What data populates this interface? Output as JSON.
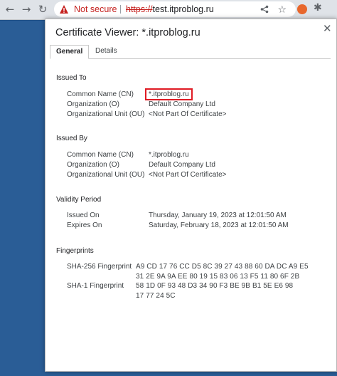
{
  "browser": {
    "back_icon": "←",
    "forward_icon": "→",
    "reload_icon": "↻",
    "security_label": "Not secure",
    "url_scheme": "https://",
    "url_rest": "test.itproblog.ru",
    "star_icon": "☆",
    "puzzle_icon": "✱"
  },
  "dialog": {
    "title": "Certificate Viewer: *.itproblog.ru",
    "close_icon": "✕",
    "tabs": [
      {
        "label": "General",
        "active": true
      },
      {
        "label": "Details",
        "active": false
      }
    ],
    "issued_to": {
      "heading": "Issued To",
      "rows": [
        {
          "label": "Common Name (CN)",
          "value": "*.itproblog.ru"
        },
        {
          "label": "Organization (O)",
          "value": "Default Company Ltd"
        },
        {
          "label": "Organizational Unit (OU)",
          "value": "<Not Part Of Certificate>"
        }
      ]
    },
    "issued_by": {
      "heading": "Issued By",
      "rows": [
        {
          "label": "Common Name (CN)",
          "value": "*.itproblog.ru"
        },
        {
          "label": "Organization (O)",
          "value": "Default Company Ltd"
        },
        {
          "label": "Organizational Unit (OU)",
          "value": "<Not Part Of Certificate>"
        }
      ]
    },
    "validity": {
      "heading": "Validity Period",
      "rows": [
        {
          "label": "Issued On",
          "value": "Thursday, January 19, 2023 at 12:01:50 AM"
        },
        {
          "label": "Expires On",
          "value": "Saturday, February 18, 2023 at 12:01:50 AM"
        }
      ]
    },
    "fingerprints": {
      "heading": "Fingerprints",
      "sha256_label": "SHA-256 Fingerprint",
      "sha256_line1": "A9 CD 17 76 CC D5 8C 39 27 43 88 60 DA DC A9 E5",
      "sha256_line2": "31 2E 9A 9A EE 80 19 15 83 06 13 F5 11 80 6F 2B",
      "sha1_label": "SHA-1 Fingerprint",
      "sha1_line1": "58 1D 0F 93 48 D3 34 90 F3 BE 9B B1 5E E6 98",
      "sha1_line2": "17 77 24 5C"
    }
  },
  "colors": {
    "not_secure": "#c5221f",
    "highlight_box": "#e01b24",
    "background": "#1f4f86"
  }
}
